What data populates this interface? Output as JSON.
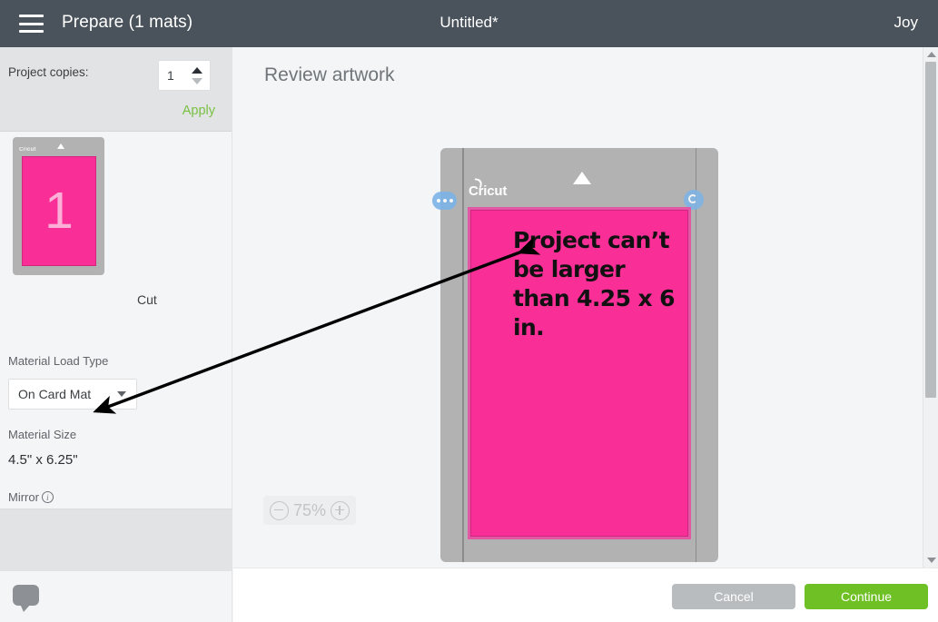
{
  "topbar": {
    "menu_icon": "hamburger-menu-icon",
    "title": "Prepare (1 mats)",
    "document_title": "Untitled*",
    "machine": "Joy"
  },
  "left_panel": {
    "copies_label": "Project copies:",
    "copies_value": "1",
    "apply_label": "Apply",
    "mat_thumbnail": {
      "brand": "Cricut",
      "number": "1",
      "operation": "Cut"
    },
    "material_load_type_label": "Material Load Type",
    "material_load_type_value": "On Card Mat",
    "material_size_label": "Material Size",
    "material_size_value": "4.5\" x 6.25\"",
    "mirror_label": "Mirror",
    "mirror_info_icon": "info-icon",
    "mirror_enabled": false,
    "chat_icon": "chat-bubble-icon"
  },
  "canvas": {
    "title": "Review artwork",
    "mat": {
      "brand": "Cricut",
      "artwork_text": "Project can’t be larger than 4.25 x 6 in.",
      "handle_dots_icon": "more-options-icon",
      "handle_rotate_icon": "rotate-icon",
      "alignment_triangle_icon": "triangle-up-icon"
    },
    "zoom": {
      "minus_icon": "zoom-out-icon",
      "level": "75%",
      "plus_icon": "zoom-in-icon"
    }
  },
  "footer": {
    "cancel_label": "Cancel",
    "continue_label": "Continue"
  },
  "scrollbar": {
    "up_icon": "scroll-up-arrow-icon",
    "down_icon": "scroll-down-arrow-icon"
  },
  "colors": {
    "topbar": "#4a535b",
    "accent_green": "#6fc024",
    "apply_green": "#7ac143",
    "material_pink": "#f92f97",
    "mat_gray": "#b2b2b2",
    "cancel_gray": "#b9bcbf"
  }
}
